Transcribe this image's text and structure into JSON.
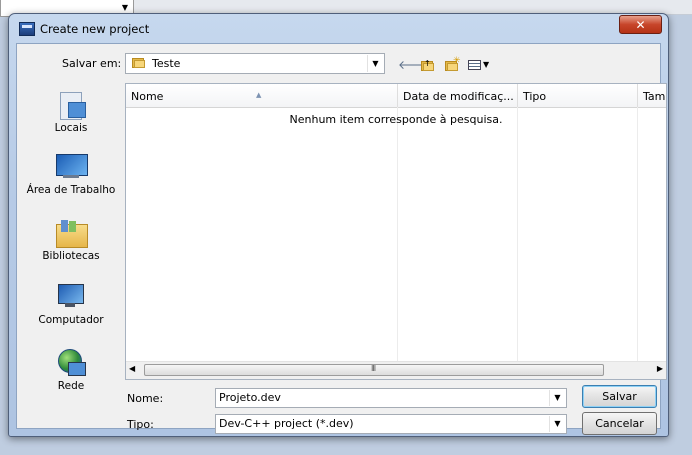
{
  "window": {
    "title": "Create new project",
    "close_glyph": "✕"
  },
  "save_in": {
    "label": "Salvar em:",
    "value": "Teste"
  },
  "toolbar": {
    "back_icon": "arrow-left-icon",
    "up_icon": "folder-up-icon",
    "new_folder_icon": "new-folder-icon",
    "view_menu_icon": "view-menu-icon"
  },
  "places": [
    {
      "label": "Locais",
      "icon": "recent-places-icon"
    },
    {
      "label": "Área de Trabalho",
      "icon": "desktop-icon"
    },
    {
      "label": "Bibliotecas",
      "icon": "libraries-icon"
    },
    {
      "label": "Computador",
      "icon": "computer-icon"
    },
    {
      "label": "Rede",
      "icon": "network-icon"
    }
  ],
  "file_list": {
    "columns": [
      "Nome",
      "Data de modificaç...",
      "Tipo",
      "Tam"
    ],
    "empty_message": "Nenhum item corresponde à pesquisa."
  },
  "name_field": {
    "label": "Nome:",
    "value": "Projeto.dev"
  },
  "type_field": {
    "label": "Tipo:",
    "value": "Dev-C++ project (*.dev)"
  },
  "buttons": {
    "save": "Salvar",
    "cancel": "Cancelar"
  },
  "colors": {
    "frame": "#b7cbe6",
    "close": "#c7452a"
  }
}
